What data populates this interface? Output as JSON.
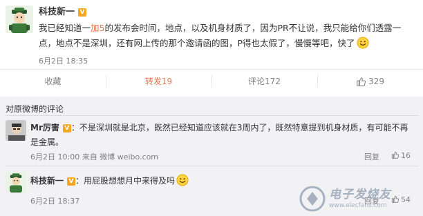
{
  "post": {
    "author": "科技新一",
    "verified_badge": "V",
    "text_before": "我已经知道一",
    "text_link": "加5",
    "text_after": "的发布会时间，地点，以及机身材质了，因为PR不让说，我只能给你们透露一点，地点不是深圳，还有网上传的那个邀请函的图，P得也太假了，慢慢等吧，快了",
    "emoji": "smile-emoji",
    "time": "6月2日 18:35"
  },
  "actions": {
    "favorite": "收藏",
    "repost": "转发19",
    "comment": "评论172",
    "like_count": "329",
    "accent": "#eb7350"
  },
  "comments_title": "对原微博的评论",
  "comments": [
    {
      "author": "Mr厉害",
      "badge": "V",
      "text": "：不是深圳就是北京，既然已经知道应该就在3周内了，既然特意提到机身材质，有可能不再是金属。",
      "time": "6月2日 10:00 来自 微博 weibo.com",
      "reply": "回复",
      "like_count": "16"
    },
    {
      "author": "科技新一",
      "badge": "V",
      "text": "：用屁股想想月中来得及吗",
      "time": "6月2日 18:37",
      "reply": "回复",
      "like_count": "54"
    }
  ],
  "watermark": {
    "name": "电子发烧友",
    "url": "www.elecfans.com"
  }
}
